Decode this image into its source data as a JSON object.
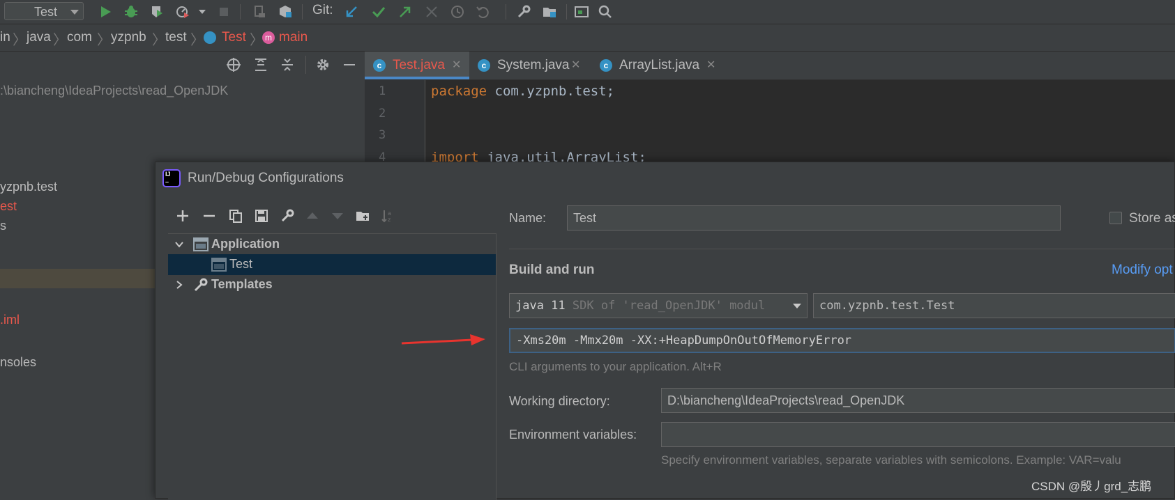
{
  "toolbar": {
    "run_config": "Test",
    "git_label": "Git:",
    "icons": [
      "run-icon",
      "debug-icon",
      "coverage-icon",
      "profile-icon",
      "stop-icon",
      "build-icon",
      "git-update-icon",
      "git-commit-icon",
      "git-push-icon",
      "git-history-icon",
      "git-rollback-icon",
      "settings-icon",
      "project-structure-icon",
      "terminal-icon",
      "search-icon"
    ]
  },
  "breadcrumb": {
    "items": [
      "in",
      "java",
      "com",
      "yzpnb",
      "test",
      "Test",
      "main"
    ]
  },
  "project": {
    "path": ":\\biancheng\\IdeaProjects\\read_OpenJDK",
    "items": [
      "yzpnb.test",
      "est",
      "s",
      ".iml",
      "nsoles"
    ]
  },
  "editor": {
    "tabs": [
      {
        "label": "Test.java",
        "active": true
      },
      {
        "label": "System.java",
        "active": false
      },
      {
        "label": "ArrayList.java",
        "active": false
      }
    ],
    "lines": [
      {
        "num": "1",
        "kw": "package",
        "rest": " com.yzpnb.test;"
      },
      {
        "num": "2",
        "kw": "",
        "rest": ""
      },
      {
        "num": "3",
        "kw": "",
        "rest": ""
      },
      {
        "num": "4",
        "kw": "import",
        "rest": " java.util.ArrayList;"
      }
    ]
  },
  "dialog": {
    "title": "Run/Debug Configurations",
    "tree": {
      "application": "Application",
      "test": "Test",
      "templates": "Templates"
    },
    "name_label": "Name:",
    "name_value": "Test",
    "store_label": "Store as",
    "build_run": "Build and run",
    "modify": "Modify opt",
    "sdk_value": "java 11",
    "sdk_hint": "SDK of 'read_OpenJDK' modul",
    "main_class": "com.yzpnb.test.Test",
    "vm_options": "-Xms20m -Mmx20m -XX:+HeapDumpOnOutOfMemoryError",
    "cli_hint": "CLI arguments to your application. Alt+R",
    "workdir_label": "Working directory:",
    "workdir_value": "D:\\biancheng\\IdeaProjects\\read_OpenJDK",
    "env_label": "Environment variables:",
    "env_value": "",
    "env_hint": "Specify environment variables, separate variables with semicolons. Example: VAR=valu"
  },
  "watermark": "CSDN @殷丿grd_志鹏",
  "colors": {
    "accent_red": "#e8584c",
    "link_blue": "#589df6",
    "selection": "#0d293e",
    "arrow_red": "#e8342e"
  }
}
